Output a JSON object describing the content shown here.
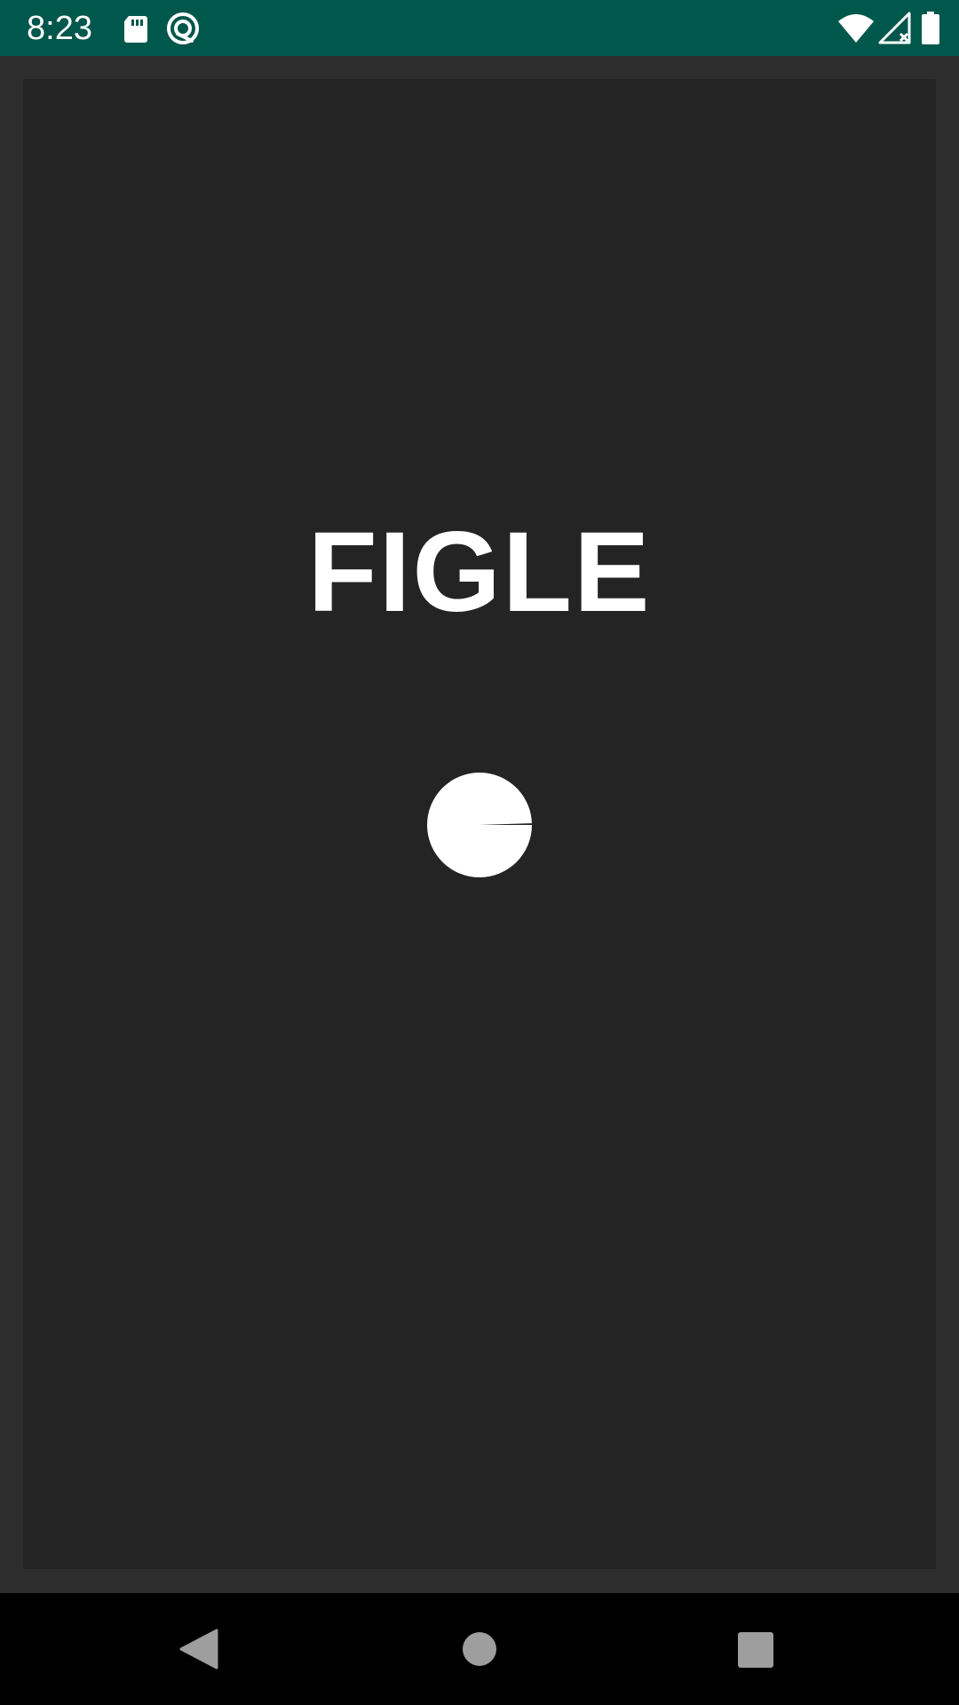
{
  "status_bar": {
    "time": "8:23",
    "background_color": "#00574b",
    "left_icons": [
      "sd-card-icon",
      "sync-icon"
    ],
    "right_icons": [
      "wifi-icon",
      "signal-no-data-icon",
      "battery-icon"
    ]
  },
  "app": {
    "title": "FIGLE",
    "background_color": "#242424",
    "loading_indicator": "spinner-icon"
  },
  "nav_bar": {
    "buttons": [
      "back-button",
      "home-button",
      "recents-button"
    ]
  }
}
